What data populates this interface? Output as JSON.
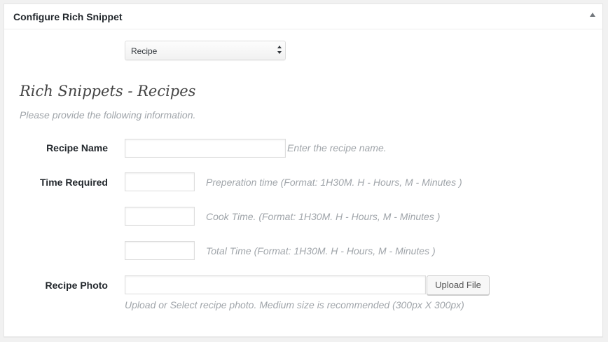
{
  "metabox": {
    "title": "Configure Rich Snippet",
    "toggle_icon": "triangle-up"
  },
  "type_select": {
    "selected": "Recipe"
  },
  "section": {
    "heading": "Rich Snippets - Recipes",
    "description": "Please provide the following information."
  },
  "fields": {
    "recipe_name": {
      "label": "Recipe Name",
      "value": "",
      "hint": "Enter the recipe name."
    },
    "time_required": {
      "label": "Time Required",
      "prep": {
        "value": "",
        "hint": "Preperation time (Format: 1H30M. H - Hours, M - Minutes )"
      },
      "cook": {
        "value": "",
        "hint": "Cook Time. (Format: 1H30M. H - Hours, M - Minutes )"
      },
      "total": {
        "value": "",
        "hint": "Total Time (Format: 1H30M. H - Hours, M - Minutes )"
      }
    },
    "recipe_photo": {
      "label": "Recipe Photo",
      "value": "",
      "button_label": "Upload File",
      "hint": "Upload or Select recipe photo. Medium size is recommended (300px X 300px)"
    }
  },
  "colors": {
    "background": "#f1f1f1",
    "panel": "#ffffff",
    "hint_text": "#a0a5aa",
    "label_text": "#23282d"
  }
}
